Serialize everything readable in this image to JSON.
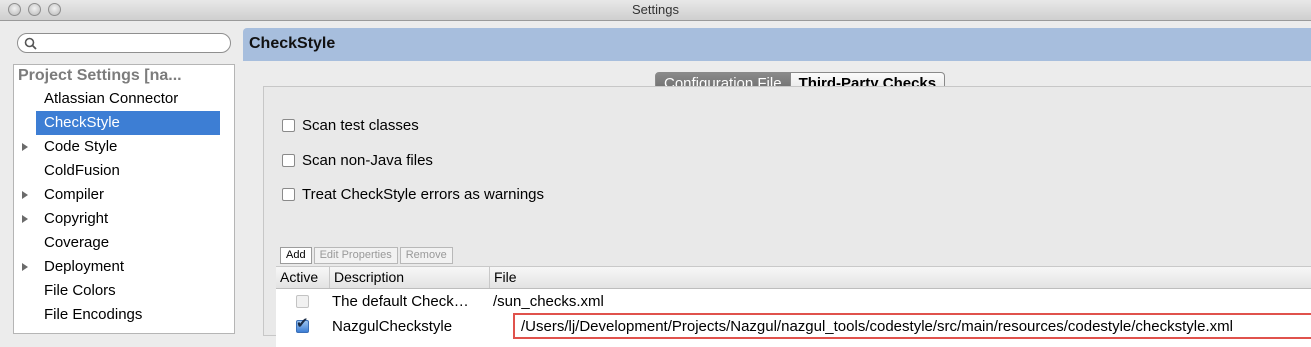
{
  "window": {
    "title": "Settings"
  },
  "sidebar": {
    "search": {
      "placeholder": ""
    },
    "section_header": "Project Settings [na...",
    "items": [
      {
        "label": "Atlassian Connector",
        "expandable": false,
        "selected": false
      },
      {
        "label": "CheckStyle",
        "expandable": false,
        "selected": true
      },
      {
        "label": "Code Style",
        "expandable": true,
        "selected": false
      },
      {
        "label": "ColdFusion",
        "expandable": false,
        "selected": false
      },
      {
        "label": "Compiler",
        "expandable": true,
        "selected": false
      },
      {
        "label": "Copyright",
        "expandable": true,
        "selected": false
      },
      {
        "label": "Coverage",
        "expandable": false,
        "selected": false
      },
      {
        "label": "Deployment",
        "expandable": true,
        "selected": false
      },
      {
        "label": "File Colors",
        "expandable": false,
        "selected": false
      },
      {
        "label": "File Encodings",
        "expandable": false,
        "selected": false
      }
    ]
  },
  "main": {
    "title": "CheckStyle",
    "tabs": [
      {
        "label": "Configuration File",
        "active": true
      },
      {
        "label": "Third-Party Checks",
        "active": false
      }
    ],
    "options": [
      {
        "label": "Scan test classes",
        "checked": false
      },
      {
        "label": "Scan non-Java files",
        "checked": false
      },
      {
        "label": "Treat CheckStyle errors as warnings",
        "checked": false
      }
    ],
    "buttons": {
      "add": "Add",
      "edit": "Edit Properties",
      "remove": "Remove"
    },
    "table": {
      "columns": [
        "Active",
        "Description",
        "File"
      ],
      "rows": [
        {
          "active": false,
          "enabled": false,
          "description": "The default Check…",
          "file": "/sun_checks.xml"
        },
        {
          "active": true,
          "enabled": true,
          "description": "NazgulCheckstyle",
          "file": "/Users/lj/Development/Projects/Nazgul/nazgul_tools/codestyle/src/main/resources/codestyle/checkstyle.xml"
        }
      ]
    }
  },
  "colors": {
    "header_bar": "#a7bedd",
    "selection": "#3d7ed4",
    "highlight_outline": "#e0524c"
  }
}
